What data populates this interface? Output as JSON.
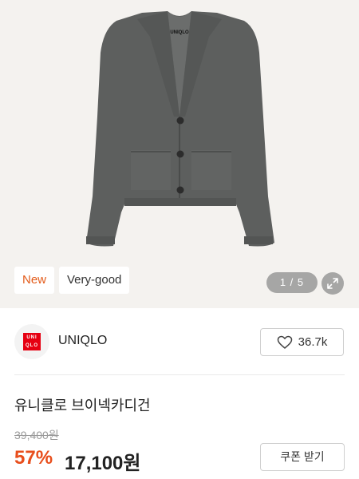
{
  "product": {
    "image_counter": "1 / 5",
    "tags": {
      "new": "New",
      "grade": "Very-good"
    },
    "image_label": "UNIQLO",
    "title": "유니클로 브이넥카디건",
    "original_price": "39,400원",
    "discount": "57%",
    "price": "17,100원",
    "coupon_label": "쿠폰 받기"
  },
  "brand": {
    "name": "UNIQLO",
    "logo_text": [
      "UNI",
      "QLO"
    ],
    "like_count": "36.7k"
  },
  "colors": {
    "accent": "#e84e1c",
    "tag_new": "#e35b1a",
    "background": "#f4f2ef",
    "logo_red": "#e60012",
    "cardigan": "#5d5f5e"
  },
  "icons": {
    "expand": "expand-icon",
    "like": "heart-icon"
  }
}
